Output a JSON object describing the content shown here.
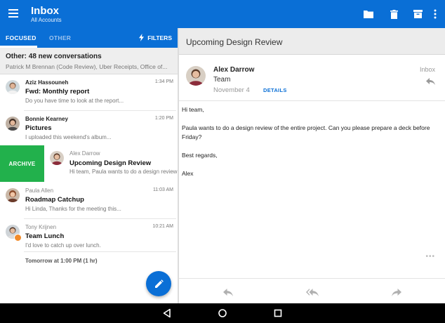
{
  "appbar": {
    "title": "Inbox",
    "subtitle": "All Accounts",
    "menu_icon": "hamburger-menu-icon",
    "actions": [
      "folder-icon",
      "delete-icon",
      "archive-icon",
      "overflow-menu-icon"
    ],
    "color": "#0a6fd6"
  },
  "tabs": {
    "focused": "FOCUSED",
    "other": "OTHER",
    "filters": "FILTERS"
  },
  "other_summary": {
    "title": "Other: 48 new conversations",
    "senders": "Patrick M Brennan (Code Review), Uber Receipts, Office of..."
  },
  "messages": [
    {
      "sender": "Aziz Hassouneh",
      "time": "1:34 PM",
      "subject": "Fwd: Monthly report",
      "preview": "Do you have time to look at the report..."
    },
    {
      "sender": "Bonnie Kearney",
      "time": "1:20 PM",
      "subject": "Pictures",
      "preview": "I uploaded this weekend's album..."
    },
    {
      "sender": "Alex Darrow",
      "time": "",
      "subject": "Upcoming Design Review",
      "preview": "Hi team, Paula wants to do a design review",
      "swipe_action": "ARCHIVE"
    },
    {
      "sender": "Paula Allen",
      "time": "11:03 AM",
      "subject": "Roadmap Catchup",
      "preview": "Hi Linda, Thanks for the meeting this..."
    },
    {
      "sender": "Tony Krijnen",
      "time": "10:21 AM",
      "subject": "Team Lunch",
      "preview": "I'd love to catch up over lunch.",
      "event": "Tomorrow at 1:00 PM (1 hr)"
    }
  ],
  "fab_icon": "compose-pencil-icon",
  "reader": {
    "title": "Upcoming Design Review",
    "from": "Alex Darrow",
    "to": "Team",
    "date": "November 4",
    "details": "DETAILS",
    "folder": "Inbox",
    "body": [
      "Hi team,",
      "Paula wants to do a design review of the entire project. Can you please prepare a deck before Friday?",
      "Best regards,",
      "Alex"
    ],
    "more": "•••",
    "footer_actions": [
      "reply-icon",
      "reply-all-icon",
      "forward-icon"
    ]
  },
  "navbar": [
    "back-icon",
    "home-icon",
    "recents-icon"
  ]
}
